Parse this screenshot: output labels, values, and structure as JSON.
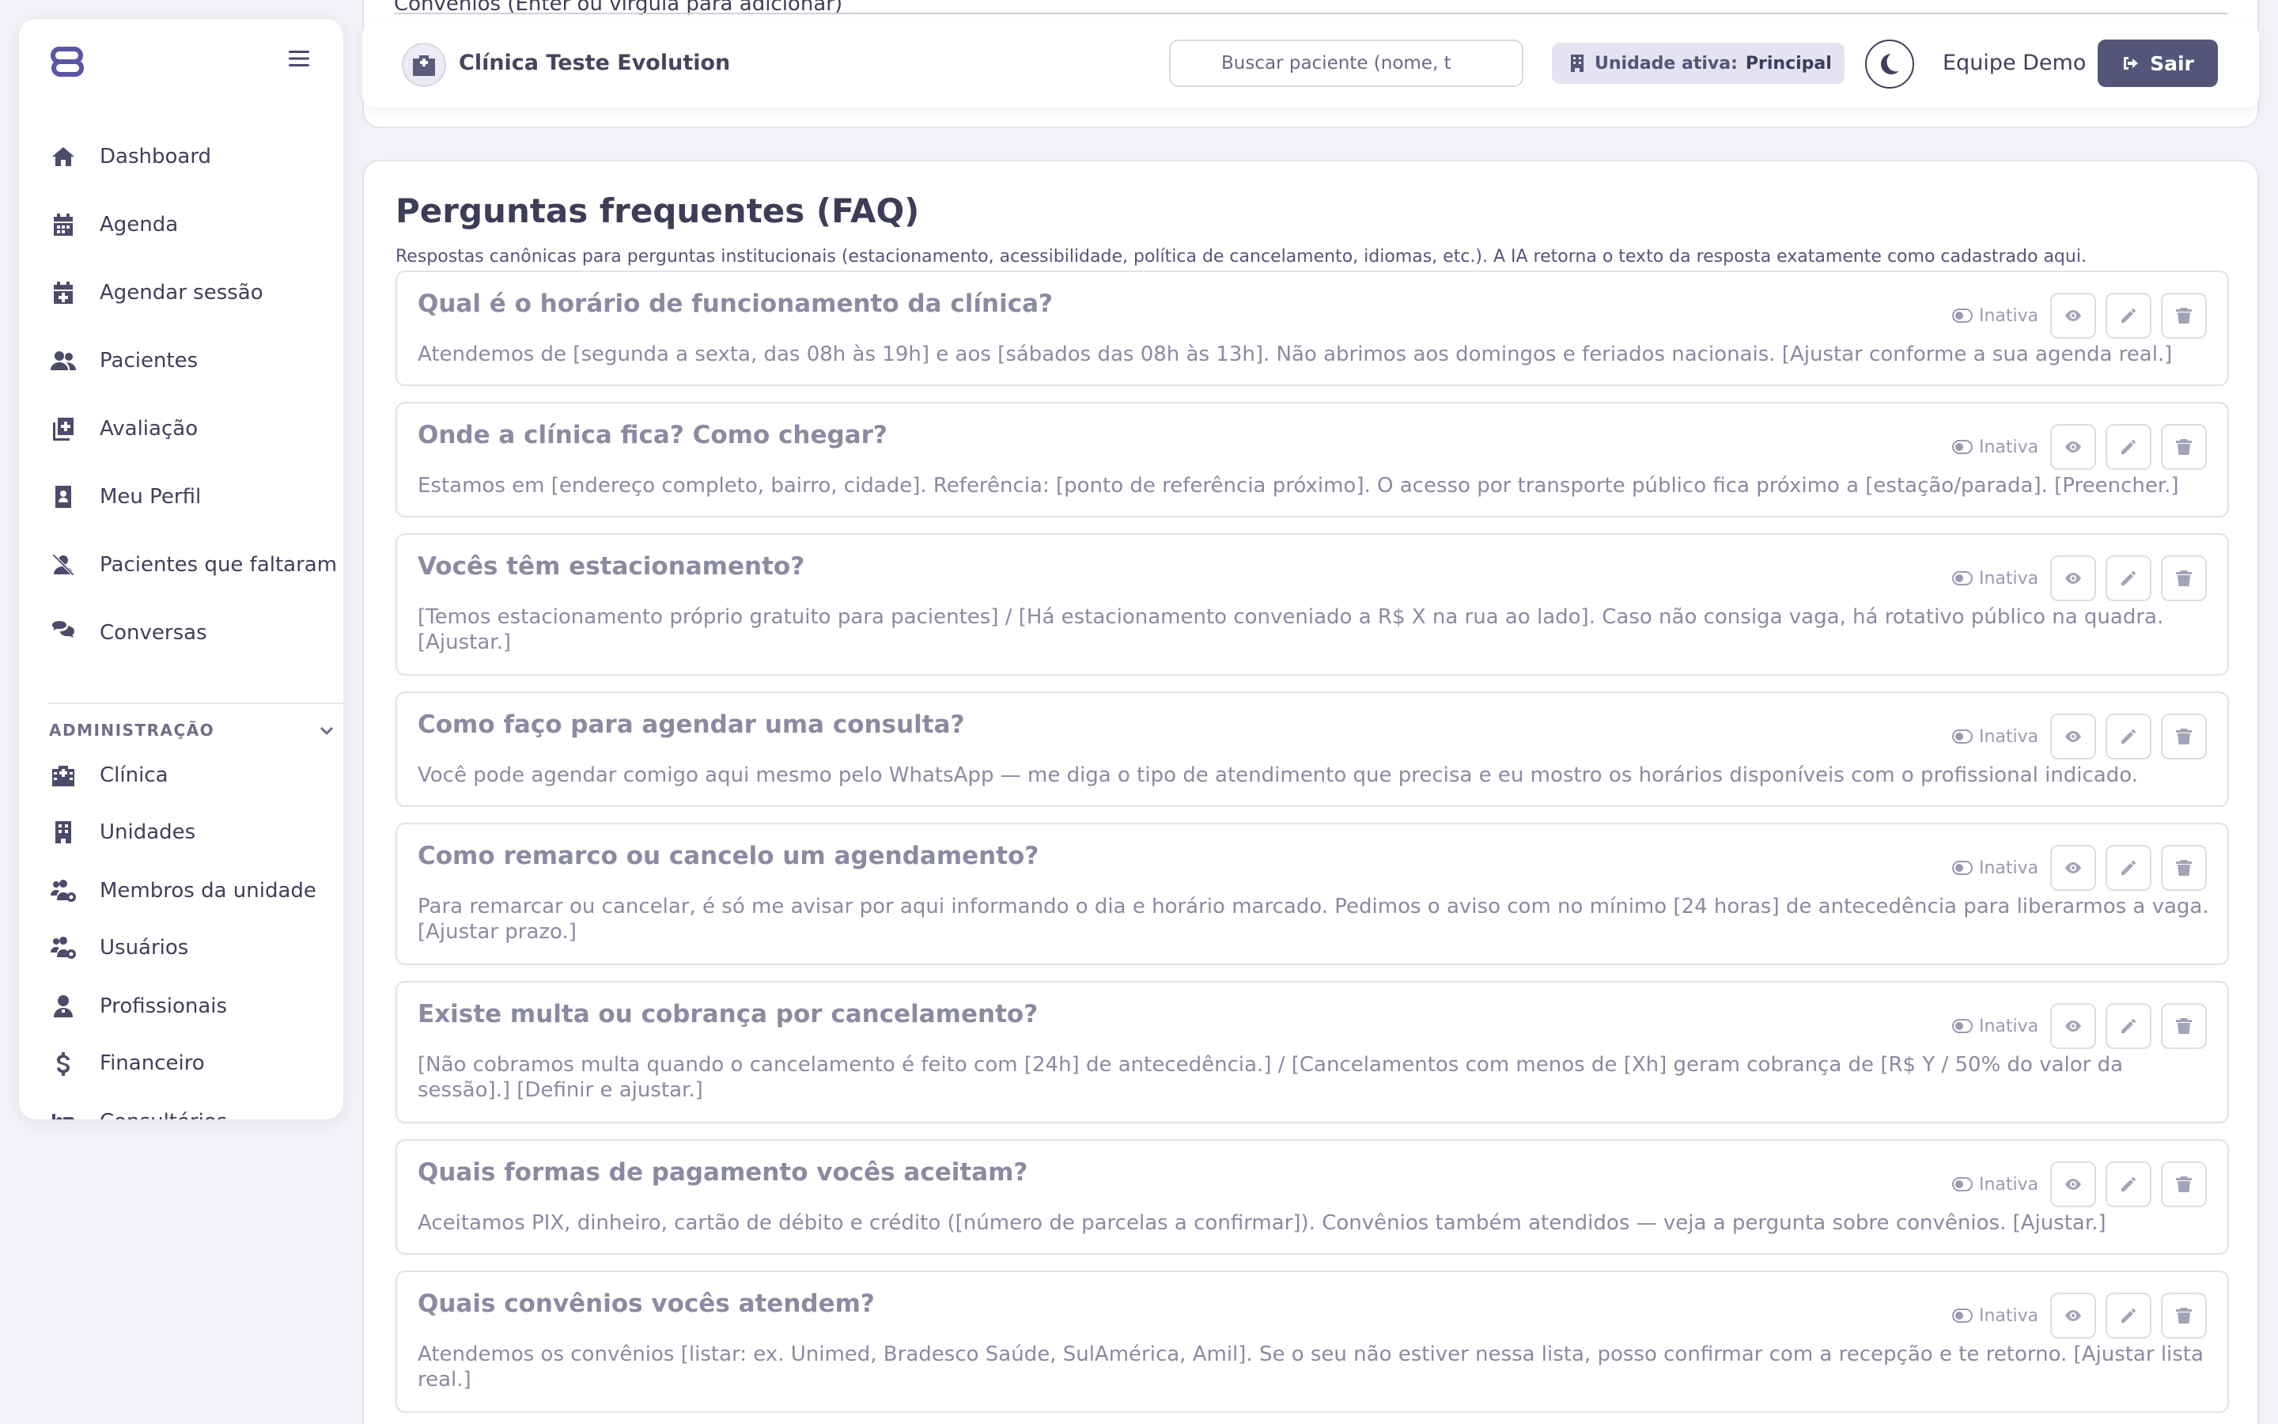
{
  "sidebar": {
    "menu_icon": "hamburger-icon",
    "items": [
      {
        "label": "Dashboard",
        "icon": "home-icon"
      },
      {
        "label": "Agenda",
        "icon": "calendar-icon"
      },
      {
        "label": "Agendar sessão",
        "icon": "calendar-plus-icon"
      },
      {
        "label": "Pacientes",
        "icon": "users-icon"
      },
      {
        "label": "Avaliação",
        "icon": "clipboard-plus-icon"
      },
      {
        "label": "Meu Perfil",
        "icon": "id-badge-icon"
      },
      {
        "label": "Pacientes que faltaram",
        "icon": "user-slash-icon"
      },
      {
        "label": "Conversas",
        "icon": "comments-icon"
      }
    ],
    "admin_section": {
      "title": "ADMINISTRAÇÃO",
      "items": [
        {
          "label": "Clínica",
          "icon": "hospital-icon"
        },
        {
          "label": "Unidades",
          "icon": "building-icon"
        },
        {
          "label": "Membros da unidade",
          "icon": "users-cog-icon"
        },
        {
          "label": "Usuários",
          "icon": "users-gear-icon"
        },
        {
          "label": "Profissionais",
          "icon": "user-doctor-icon"
        },
        {
          "label": "Financeiro",
          "icon": "dollar-icon"
        },
        {
          "label": "Consultórios",
          "icon": "bed-icon"
        }
      ]
    }
  },
  "previous_section": {
    "field_label": "Convênios (Enter ou vírgula para adicionar)"
  },
  "header": {
    "clinic_name": "Clínica Teste Evolution",
    "search_placeholder": "Buscar paciente (nome, t",
    "unit_label": "Unidade ativa:",
    "unit_value": "Principal",
    "user_name": "Equipe Demo",
    "logout_label": "Sair"
  },
  "faq": {
    "title": "Perguntas frequentes (FAQ)",
    "description": "Respostas canônicas para perguntas institucionais (estacionamento, acessibilidade, política de cancelamento, idiomas, etc.). A IA retorna o texto da resposta exatamente como cadastrado aqui.",
    "items": [
      {
        "question": "Qual é o horário de funcionamento da clínica?",
        "answer": "Atendemos de [segunda a sexta, das 08h às 19h] e aos [sábados das 08h às 13h]. Não abrimos aos domingos e feriados nacionais. [Ajustar conforme a sua agenda real.]",
        "status": "Inativa"
      },
      {
        "question": "Onde a clínica fica? Como chegar?",
        "answer": "Estamos em [endereço completo, bairro, cidade]. Referência: [ponto de referência próximo]. O acesso por transporte público fica próximo a [estação/parada]. [Preencher.]",
        "status": "Inativa"
      },
      {
        "question": "Vocês têm estacionamento?",
        "answer": "[Temos estacionamento próprio gratuito para pacientes] / [Há estacionamento conveniado a R$ X na rua ao lado]. Caso não consiga vaga, há rotativo público na quadra. [Ajustar.]",
        "status": "Inativa"
      },
      {
        "question": "Como faço para agendar uma consulta?",
        "answer": "Você pode agendar comigo aqui mesmo pelo WhatsApp — me diga o tipo de atendimento que precisa e eu mostro os horários disponíveis com o profissional indicado.",
        "status": "Inativa"
      },
      {
        "question": "Como remarco ou cancelo um agendamento?",
        "answer": "Para remarcar ou cancelar, é só me avisar por aqui informando o dia e horário marcado. Pedimos o aviso com no mínimo [24 horas] de antecedência para liberarmos a vaga. [Ajustar prazo.]",
        "status": "Inativa"
      },
      {
        "question": "Existe multa ou cobrança por cancelamento?",
        "answer": "[Não cobramos multa quando o cancelamento é feito com [24h] de antecedência.] / [Cancelamentos com menos de [Xh] geram cobrança de [R$ Y / 50% do valor da sessão].] [Definir e ajustar.]",
        "status": "Inativa"
      },
      {
        "question": "Quais formas de pagamento vocês aceitam?",
        "answer": "Aceitamos PIX, dinheiro, cartão de débito e crédito ([número de parcelas a confirmar]). Convênios também atendidos — veja a pergunta sobre convênios. [Ajustar.]",
        "status": "Inativa"
      },
      {
        "question": "Quais convênios vocês atendem?",
        "answer": "Atendemos os convênios [listar: ex. Unimed, Bradesco Saúde, SulAmérica, Amil]. Se o seu não estiver nessa lista, posso confirmar com a recepção e te retorno. [Ajustar lista real.]",
        "status": "Inativa"
      }
    ]
  },
  "colors": {
    "primary": "#55557a",
    "text": "#3f3f5a",
    "muted_text": "#8a8aa2",
    "background": "#f1f2f6"
  }
}
